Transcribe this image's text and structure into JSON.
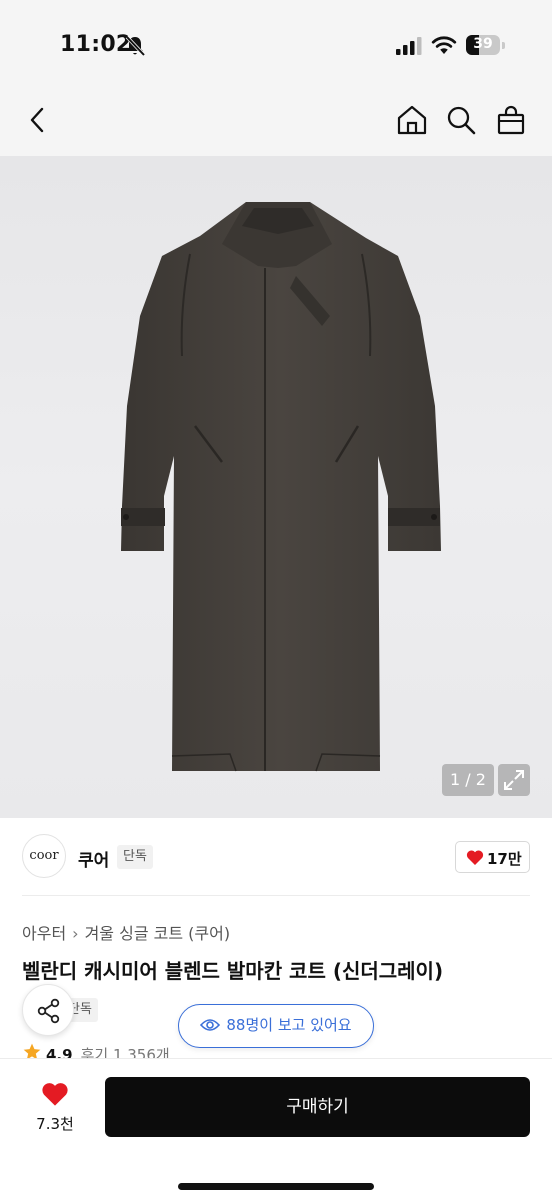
{
  "status_bar": {
    "time": "11:02",
    "battery_level": 39,
    "battery_text": "39",
    "icons": [
      "bell-slash-icon",
      "signal-icon",
      "wifi-icon",
      "battery-icon"
    ]
  },
  "nav": {
    "icons": [
      "back-chevron-icon",
      "home-icon",
      "search-icon",
      "shopping-bag-icon"
    ]
  },
  "image": {
    "counter": "1 / 2",
    "expand_icon": "expand-icon"
  },
  "seller": {
    "logo_text": "coor",
    "name": "쿠어",
    "badge": "단독",
    "likes": "17만"
  },
  "product": {
    "breadcrumb": [
      "아우터",
      "겨울 싱글 코트 (쿠어)"
    ],
    "title": "벨란디 캐시미어 블렌드 발마칸 코트 (신더그레이)",
    "tag": "단독",
    "viewers": "88명이 보고 있어요",
    "rating": "4.9",
    "reviews": "후기 1,356개"
  },
  "bottom": {
    "wish_count": "7.3천",
    "buy_label": "구매하기"
  },
  "colors": {
    "accent_blue": "#3a6fd8",
    "heart_red": "#e41b23",
    "star_orange": "#f5a623",
    "buy_black": "#0c0c0c"
  }
}
